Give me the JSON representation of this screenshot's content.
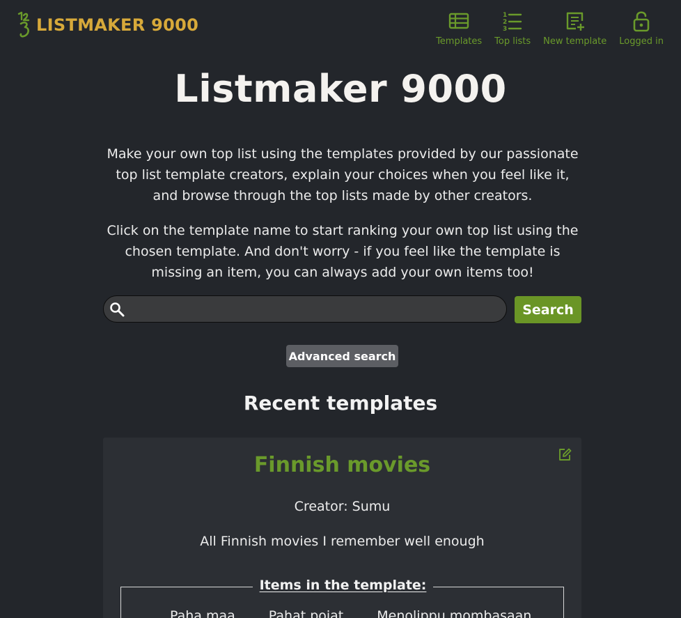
{
  "brand": {
    "name": "LISTMAKER 9000",
    "icon": "123-swirl-logo-icon"
  },
  "nav": [
    {
      "label": "Templates",
      "icon": "table-list-icon"
    },
    {
      "label": "Top lists",
      "icon": "numbered-list-icon"
    },
    {
      "label": "New template",
      "icon": "add-template-icon"
    },
    {
      "label": "Logged in",
      "icon": "unlocked-padlock-icon"
    }
  ],
  "hero": {
    "title": "Listmaker 9000",
    "intro_1": "Make your own top list using the templates provided by our passionate top list template creators, explain your choices when you feel like it, and browse through the top lists made by other creators.",
    "intro_2": "Click on the template name to start ranking your own top list using the chosen template. And don't worry - if you feel like the template is missing an item, you can always add your own items too!"
  },
  "search": {
    "value": "",
    "placeholder": "",
    "button_label": "Search",
    "advanced_label": "Advanced search"
  },
  "recent": {
    "title": "Recent templates",
    "card": {
      "title": "Finnish movies",
      "creator": "Creator: Sumu",
      "description": "All Finnish movies I remember well enough",
      "items_legend": "Items in the template:",
      "items": [
        "Paha maa",
        "Pahat pojat",
        "Menolippu mombasaan"
      ]
    }
  },
  "colors": {
    "background": "#23262b",
    "accent_green": "#6a9a2b",
    "brand_gold": "#d7a93a",
    "card_background": "#2c2f34"
  }
}
